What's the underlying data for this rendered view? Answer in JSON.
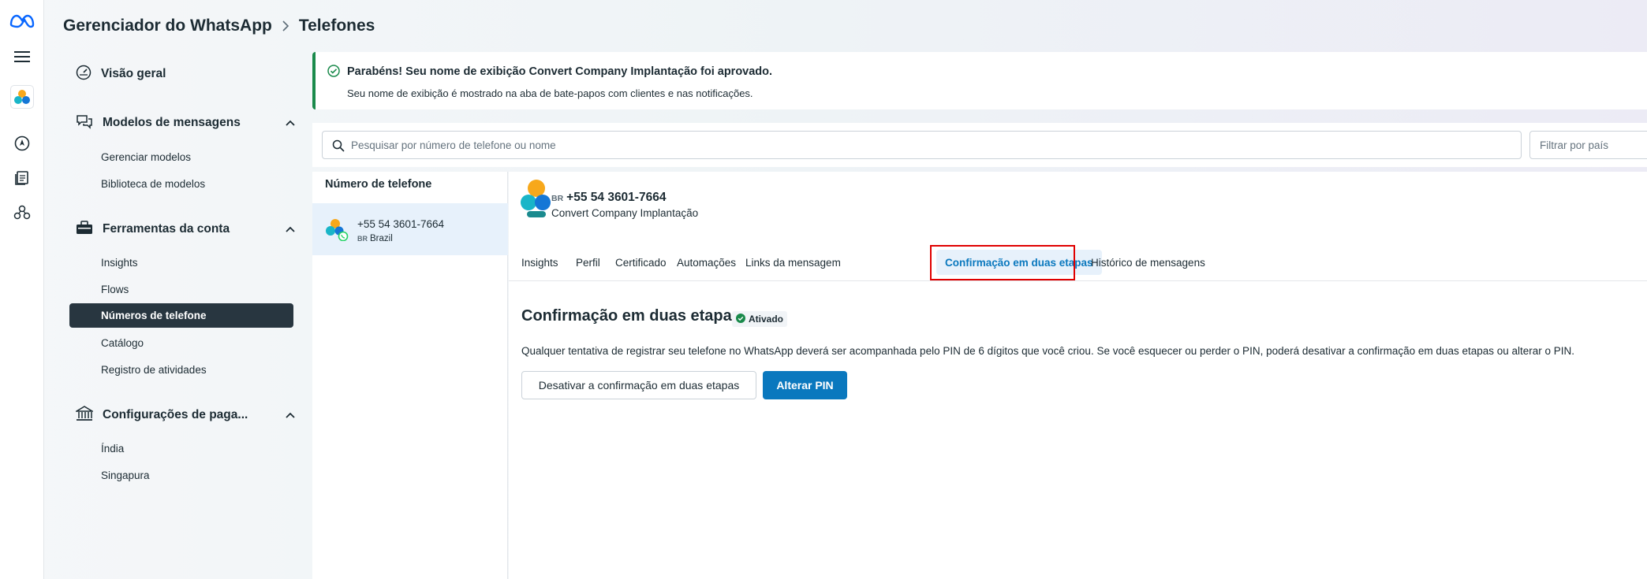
{
  "header": {
    "app_title": "Gerenciador do WhatsApp",
    "current_page": "Telefones"
  },
  "sidebar": {
    "sections": [
      {
        "label": "Visão geral",
        "icon": "speedometer-icon",
        "items": []
      },
      {
        "label": "Modelos de mensagens",
        "icon": "chat-bubbles-icon",
        "items": [
          "Gerenciar modelos",
          "Biblioteca de modelos"
        ]
      },
      {
        "label": "Ferramentas da conta",
        "icon": "toolbox-icon",
        "items": [
          "Insights",
          "Flows",
          "Números de telefone",
          "Catálogo",
          "Registro de atividades"
        ],
        "active_item": "Números de telefone"
      },
      {
        "label": "Configurações de paga...",
        "icon": "bank-icon",
        "items": [
          "Índia",
          "Singapura"
        ]
      }
    ]
  },
  "banner": {
    "title": "Parabéns! Seu nome de exibição Convert Company Implantação foi aprovado.",
    "text": "Seu nome de exibição é mostrado na aba de bate-papos com clientes e nas notificações."
  },
  "search": {
    "placeholder": "Pesquisar por número de telefone ou nome",
    "country_filter_placeholder": "Filtrar por país"
  },
  "phone_list": {
    "header": "Número de telefone",
    "rows": [
      {
        "number": "+55 54 3601-7664",
        "country_code": "BR",
        "country": "Brazil"
      }
    ]
  },
  "detail": {
    "country_code": "BR",
    "number": "+55 54 3601-7664",
    "display_name": "Convert Company Implantação",
    "tabs": [
      "Insights",
      "Perfil",
      "Certificado",
      "Automações",
      "Links da mensagem",
      "Confirmação em duas etapas",
      "Histórico de mensagens"
    ],
    "active_tab": "Confirmação em duas etapas",
    "section_title": "Confirmação em duas etapas",
    "status_badge": "Ativado",
    "description": "Qualquer tentativa de registrar seu telefone no WhatsApp deverá ser acompanhada pelo PIN de 6 dígitos que você criou. Se você esquecer ou perder o PIN, poderá desativar a confirmação em duas etapas ou alterar o PIN.",
    "disable_button": "Desativar a confirmação em duas etapas",
    "change_pin_button": "Alterar PIN"
  },
  "colors": {
    "accent": "#0a78be",
    "success": "#1a8a4b",
    "active_nav_bg": "#283640",
    "highlight_outline": "#e00000"
  }
}
